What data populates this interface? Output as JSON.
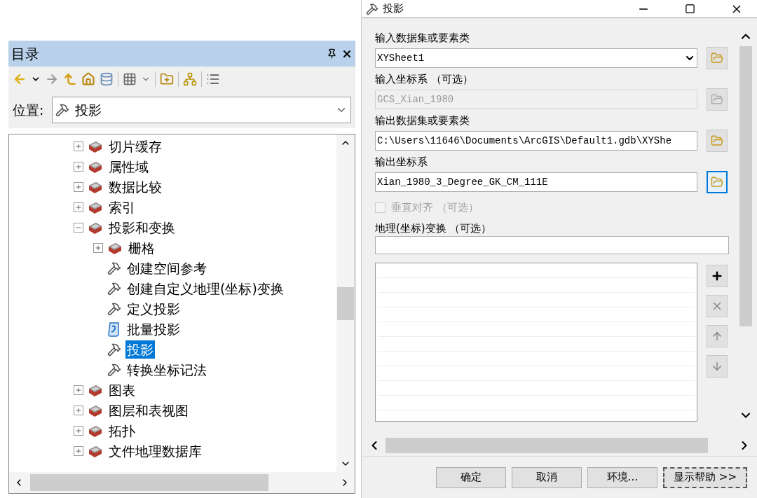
{
  "catalog": {
    "title": "目录",
    "location": {
      "label": "位置:",
      "value": "投影"
    },
    "tree": [
      {
        "label": "切片缓存",
        "kind": "toolset",
        "expanded": false,
        "selected": false
      },
      {
        "label": "属性域",
        "kind": "toolset",
        "expanded": false,
        "selected": false
      },
      {
        "label": "数据比较",
        "kind": "toolset",
        "expanded": false,
        "selected": false
      },
      {
        "label": "索引",
        "kind": "toolset",
        "expanded": false,
        "selected": false
      },
      {
        "label": "投影和变换",
        "kind": "toolset",
        "expanded": true,
        "selected": false,
        "children": [
          {
            "label": "栅格",
            "kind": "toolset",
            "expanded": false,
            "selected": false
          },
          {
            "label": "创建空间参考",
            "kind": "tool",
            "selected": false
          },
          {
            "label": "创建自定义地理(坐标)变换",
            "kind": "tool",
            "selected": false
          },
          {
            "label": "定义投影",
            "kind": "tool",
            "selected": false
          },
          {
            "label": "批量投影",
            "kind": "script",
            "selected": false
          },
          {
            "label": "投影",
            "kind": "tool",
            "selected": true
          },
          {
            "label": "转换坐标记法",
            "kind": "tool",
            "selected": false
          }
        ]
      },
      {
        "label": "图表",
        "kind": "toolset",
        "expanded": false,
        "selected": false
      },
      {
        "label": "图层和表视图",
        "kind": "toolset",
        "expanded": false,
        "selected": false
      },
      {
        "label": "拓扑",
        "kind": "toolset",
        "expanded": false,
        "selected": false
      },
      {
        "label": "文件地理数据库",
        "kind": "toolset",
        "expanded": false,
        "selected": false
      }
    ]
  },
  "dialog": {
    "title": "投影",
    "parameters": [
      {
        "kind": "combo",
        "label": "输入数据集或要素类",
        "value": "XYSheet1",
        "disabled": false,
        "focused": false
      },
      {
        "kind": "text",
        "label": "输入坐标系 （可选）",
        "value": "GCS_Xian_1980",
        "disabled": true,
        "focused": false
      },
      {
        "kind": "text",
        "label": "输出数据集或要素类",
        "value": "C:\\Users\\11646\\Documents\\ArcGIS\\Default1.gdb\\XYShe",
        "disabled": false,
        "focused": false
      },
      {
        "kind": "text",
        "label": "输出坐标系",
        "value": "Xian_1980_3_Degree_GK_CM_111E",
        "disabled": false,
        "focused": true
      },
      {
        "kind": "checkbox",
        "label": "垂直对齐 （可选）",
        "checked": false,
        "disabled": true
      },
      {
        "kind": "transform",
        "label": "地理(坐标)变换 （可选）",
        "list_buttons": [
          {
            "kind": "add",
            "disabled": false
          },
          {
            "kind": "remove",
            "disabled": true
          },
          {
            "kind": "up",
            "disabled": true
          },
          {
            "kind": "down",
            "disabled": true
          }
        ]
      }
    ],
    "buttons": [
      {
        "label": "确定",
        "focused": false
      },
      {
        "label": "取消",
        "focused": false
      },
      {
        "label": "环境...",
        "focused": false
      },
      {
        "label": "显示帮助 >>",
        "focused": true
      }
    ]
  }
}
